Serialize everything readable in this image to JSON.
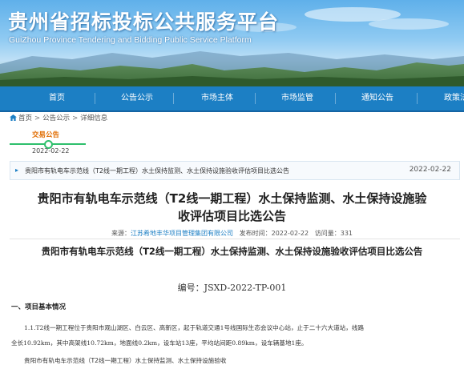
{
  "header": {
    "site_title": "贵州省招标投标公共服务平台",
    "site_subtitle": "GuiZhou Province Tendering and Bidding Public Service Platform"
  },
  "nav": {
    "items": [
      {
        "label": "首页"
      },
      {
        "label": "公告公示"
      },
      {
        "label": "市场主体"
      },
      {
        "label": "市场监管"
      },
      {
        "label": "通知公告"
      },
      {
        "label": "政策法"
      }
    ]
  },
  "breadcrumb": {
    "items": [
      "首页",
      "公告公示",
      "详细信息"
    ]
  },
  "stage": {
    "label": "交易公告",
    "date": "2022-02-22"
  },
  "notice_row": {
    "title": "贵阳市有轨电车示范线（T2线一期工程）水土保持监测、水土保持设施验收评估项目比选公告",
    "date": "2022-02-22"
  },
  "article": {
    "title_line1": "贵阳市有轨电车示范线（T2线一期工程）水土保持监测、水土保持设施验",
    "title_line2": "收评估项目比选公告",
    "source_label": "来源：",
    "source": "江苏希地丰华项目管理集团有限公司",
    "publish_label": "发布时间：",
    "publish_time": "2022-02-22",
    "visits_label": "访问量：",
    "visits": "331",
    "subtitle": "贵阳市有轨电车示范线（T2线一期工程）水土保持监测、水土保持设施验收评估项目比选公告",
    "number_label": "编号：",
    "number": "JSXD-2022-TP-001",
    "section1": "一、项目基本情况",
    "para1_line1": "1.1.T2线一期工程位于贵阳市观山湖区、白云区、高新区，起于轨道交通1号线国际生态会议中心站，止于二十六大道站，线路",
    "para1_line2": "全长10.92km，其中高架线10.72km，地面线0.2km，设车站13座，平均站间距0.89km，设车辆基地1座。",
    "para1_line3": "贵阳市有轨电车示范线（T2线一期工程）水土保持监测、水土保持设施验收"
  },
  "colors": {
    "nav_bg": "#1c7fc4",
    "stage_accent": "#2fbf6c",
    "stage_label": "#e06c00",
    "link": "#1c7fc4"
  }
}
